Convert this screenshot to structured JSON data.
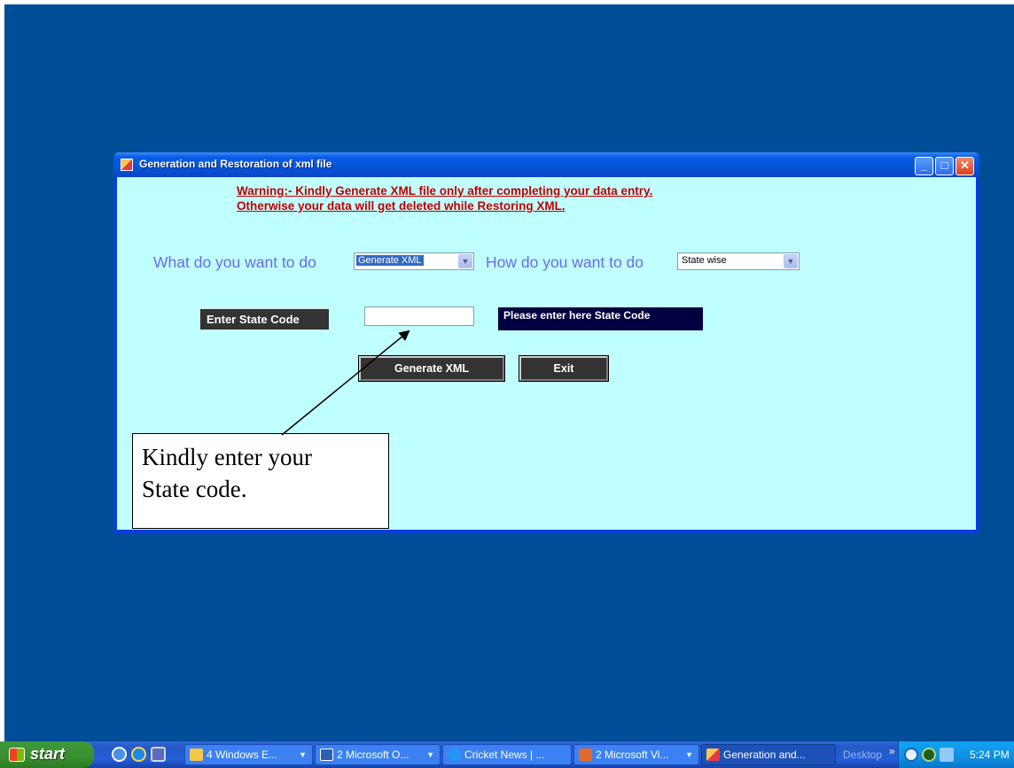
{
  "window": {
    "title": "Generation and Restoration of xml file",
    "controls": {
      "minimize": "_",
      "maximize": "□",
      "close": "✕"
    }
  },
  "warning": {
    "line1": "Warning:- Kindly Generate XML file only after completing your data entry.",
    "line2": "Otherwise your data will get deleted while Restoring XML."
  },
  "form": {
    "what_label": "What do you want to do",
    "what_value": "Generate XML",
    "how_label": "How do you want to do",
    "how_value": "State wise",
    "state_code_label": "Enter State Code",
    "state_code_value": "",
    "hint": "Please enter here State Code",
    "generate_button": "Generate XML",
    "exit_button": "Exit"
  },
  "callout": {
    "line1": "Kindly enter your",
    "line2": "State code."
  },
  "taskbar": {
    "start_label": "start",
    "tasks": [
      {
        "label": "4 Windows E...",
        "icon": "folder-icon"
      },
      {
        "label": "2 Microsoft O...",
        "icon": "word-icon"
      },
      {
        "label": "Cricket News | ...",
        "icon": "ie-icon"
      },
      {
        "label": "2 Microsoft Vi...",
        "icon": "visual-studio-icon"
      },
      {
        "label": "Generation and...",
        "icon": "app-icon"
      }
    ],
    "desktop_label": "Desktop",
    "clock": "5:24 PM"
  },
  "colors": {
    "desktop": "#004e98",
    "client_background": "#c0ffff",
    "warning_text": "#c00000",
    "question_text": "#6b6be8"
  }
}
